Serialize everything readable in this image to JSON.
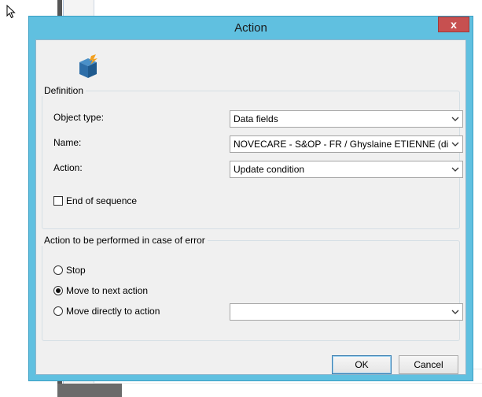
{
  "dialog": {
    "title": "Action",
    "close_glyph": "x",
    "icon": "action-cube-icon"
  },
  "definition": {
    "group_label": "Definition",
    "object_type_label": "Object type:",
    "object_type_value": "Data fields",
    "name_label": "Name:",
    "name_value": "NOVECARE - S&OP - FR / Ghyslaine ETIENNE (di",
    "action_label": "Action:",
    "action_value": "Update condition",
    "end_of_sequence_label": "End of sequence",
    "end_of_sequence_checked": false
  },
  "error_handling": {
    "group_label": "Action to be performed in case of error",
    "options": [
      {
        "label": "Stop",
        "checked": false
      },
      {
        "label": "Move to next action",
        "checked": true
      },
      {
        "label": "Move directly to action",
        "checked": false
      }
    ],
    "target_action_value": ""
  },
  "buttons": {
    "ok_label": "OK",
    "cancel_label": "Cancel"
  },
  "colors": {
    "title_bar": "#60c0e0",
    "close_button": "#c75050",
    "client_bg": "#f0f0f0"
  }
}
